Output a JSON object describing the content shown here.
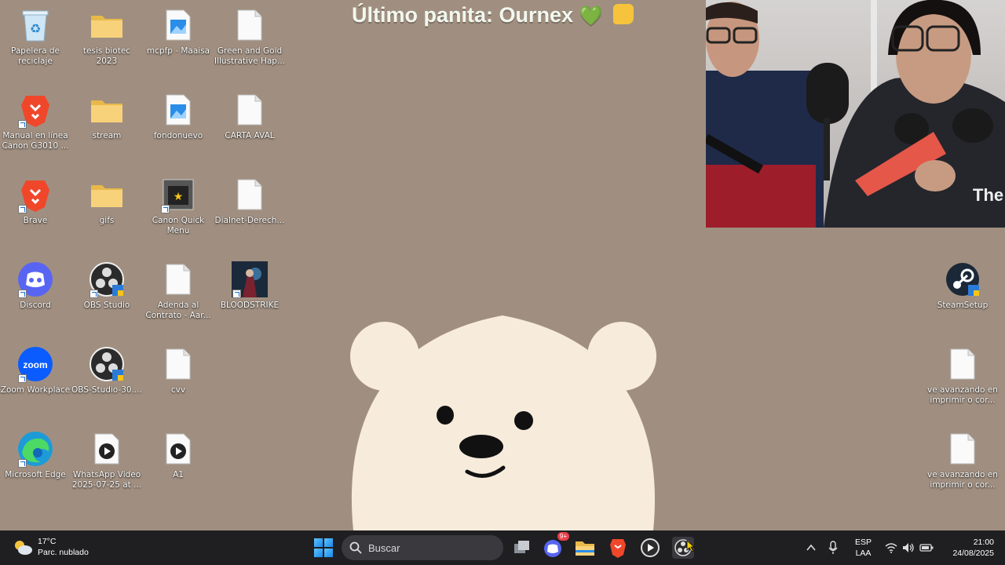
{
  "overlay": {
    "title": "Último panita: Ournex",
    "heart": "💚"
  },
  "desktop_icons": [
    {
      "label": "Papelera de reciclaje",
      "icon": "recycle-bin-icon"
    },
    {
      "label": "tesis biotec 2023",
      "icon": "folder-icon"
    },
    {
      "label": "mcpfp - Maaisa",
      "icon": "image-file-icon"
    },
    {
      "label": "Green and Gold Illustrative Hap...",
      "icon": "document-icon"
    },
    {
      "label": "Manual en línea Canon G3010 ...",
      "icon": "brave-browser-icon"
    },
    {
      "label": "stream",
      "icon": "folder-icon"
    },
    {
      "label": "fondonuevo",
      "icon": "image-file-icon"
    },
    {
      "label": "CARTA AVAL",
      "icon": "document-icon"
    },
    {
      "label": "Brave",
      "icon": "brave-browser-icon"
    },
    {
      "label": "gifs",
      "icon": "folder-icon"
    },
    {
      "label": "Canon Quick Menu",
      "icon": "canon-quick-menu-icon"
    },
    {
      "label": "Dialnet-Derech...",
      "icon": "document-icon"
    },
    {
      "label": "Discord",
      "icon": "discord-icon"
    },
    {
      "label": "OBS Studio",
      "icon": "obs-studio-icon"
    },
    {
      "label": "Adenda al Contrato - Aar...",
      "icon": "document-icon"
    },
    {
      "label": "BLOODSTRIKE",
      "icon": "bloodstrike-game-icon"
    },
    {
      "label": "Zoom Workplace",
      "icon": "zoom-icon"
    },
    {
      "label": "OBS-Studio-30....",
      "icon": "obs-studio-icon"
    },
    {
      "label": "cvv",
      "icon": "document-icon"
    },
    {
      "label": "Microsoft Edge",
      "icon": "edge-icon"
    },
    {
      "label": "WhatsApp Video 2025-07-25 at ...",
      "icon": "video-file-icon"
    },
    {
      "label": "A1",
      "icon": "video-file-icon"
    },
    {
      "label": "SteamSetup",
      "icon": "steam-icon"
    },
    {
      "label": "ve avanzando en imprimir o cor...",
      "icon": "document-icon"
    },
    {
      "label": "ve avanzando en imprimir o cor...",
      "icon": "document-icon"
    }
  ],
  "taskbar": {
    "weather_temp": "17°C",
    "weather_desc": "Parc. nublado",
    "search_placeholder": "Buscar",
    "discord_badge": "9+",
    "language_top": "ESP",
    "language_bottom": "LAA",
    "time": "21:00",
    "date": "24/08/2025"
  },
  "colors": {
    "desktop_bg": "#a08f80",
    "bear_fill": "#f7ebdc",
    "taskbar_bg": "#1f1f22",
    "overlay_text": "#f2f8ef"
  }
}
